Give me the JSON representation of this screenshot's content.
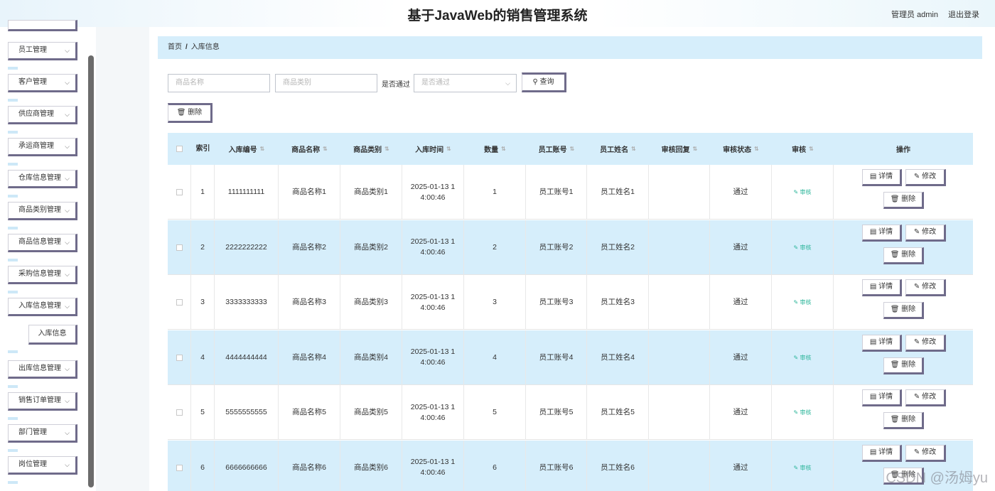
{
  "header": {
    "title": "基于JavaWeb的销售管理系统",
    "user": "管理员 admin",
    "logout": "退出登录"
  },
  "sidebar": {
    "items": [
      {
        "label": "员工管理"
      },
      {
        "label": "客户管理"
      },
      {
        "label": "供应商管理"
      },
      {
        "label": "承运商管理"
      },
      {
        "label": "仓库信息管理"
      },
      {
        "label": "商品类别管理"
      },
      {
        "label": "商品信息管理"
      },
      {
        "label": "采购信息管理"
      },
      {
        "label": "入库信息管理"
      },
      {
        "label": "出库信息管理"
      },
      {
        "label": "销售订单管理"
      },
      {
        "label": "部门管理"
      },
      {
        "label": "岗位管理"
      }
    ],
    "sub_item": "入库信息"
  },
  "breadcrumb": {
    "home": "首页",
    "sep": "/",
    "current": "入库信息"
  },
  "search": {
    "name_placeholder": "商品名称",
    "category_placeholder": "商品类别",
    "passed_label": "是否通过",
    "passed_placeholder": "是否通过",
    "query_label": "查询",
    "delete_label": "删除"
  },
  "table": {
    "headers": [
      "索引",
      "入库编号",
      "商品名称",
      "商品类别",
      "入库时间",
      "数量",
      "员工账号",
      "员工姓名",
      "审核回复",
      "审核状态",
      "审核",
      "操作"
    ],
    "rows": [
      {
        "index": "1",
        "code": "1111111111",
        "name": "商品名称1",
        "category": "商品类别1",
        "time1": "2025-01-13 1",
        "time2": "4:00:46",
        "qty": "1",
        "account": "员工账号1",
        "staff": "员工姓名1",
        "reply": "",
        "status": "通过"
      },
      {
        "index": "2",
        "code": "2222222222",
        "name": "商品名称2",
        "category": "商品类别2",
        "time1": "2025-01-13 1",
        "time2": "4:00:46",
        "qty": "2",
        "account": "员工账号2",
        "staff": "员工姓名2",
        "reply": "",
        "status": "通过"
      },
      {
        "index": "3",
        "code": "3333333333",
        "name": "商品名称3",
        "category": "商品类别3",
        "time1": "2025-01-13 1",
        "time2": "4:00:46",
        "qty": "3",
        "account": "员工账号3",
        "staff": "员工姓名3",
        "reply": "",
        "status": "通过"
      },
      {
        "index": "4",
        "code": "4444444444",
        "name": "商品名称4",
        "category": "商品类别4",
        "time1": "2025-01-13 1",
        "time2": "4:00:46",
        "qty": "4",
        "account": "员工账号4",
        "staff": "员工姓名4",
        "reply": "",
        "status": "通过"
      },
      {
        "index": "5",
        "code": "5555555555",
        "name": "商品名称5",
        "category": "商品类别5",
        "time1": "2025-01-13 1",
        "time2": "4:00:46",
        "qty": "5",
        "account": "员工账号5",
        "staff": "员工姓名5",
        "reply": "",
        "status": "通过"
      },
      {
        "index": "6",
        "code": "6666666666",
        "name": "商品名称6",
        "category": "商品类别6",
        "time1": "2025-01-13 1",
        "time2": "4:00:46",
        "qty": "6",
        "account": "员工账号6",
        "staff": "员工姓名6",
        "reply": "",
        "status": "通过"
      }
    ],
    "audit_label": "审核",
    "detail_label": "详情",
    "edit_label": "修改",
    "delete_label": "删除"
  },
  "watermark": "CSDN @汤姆yu"
}
